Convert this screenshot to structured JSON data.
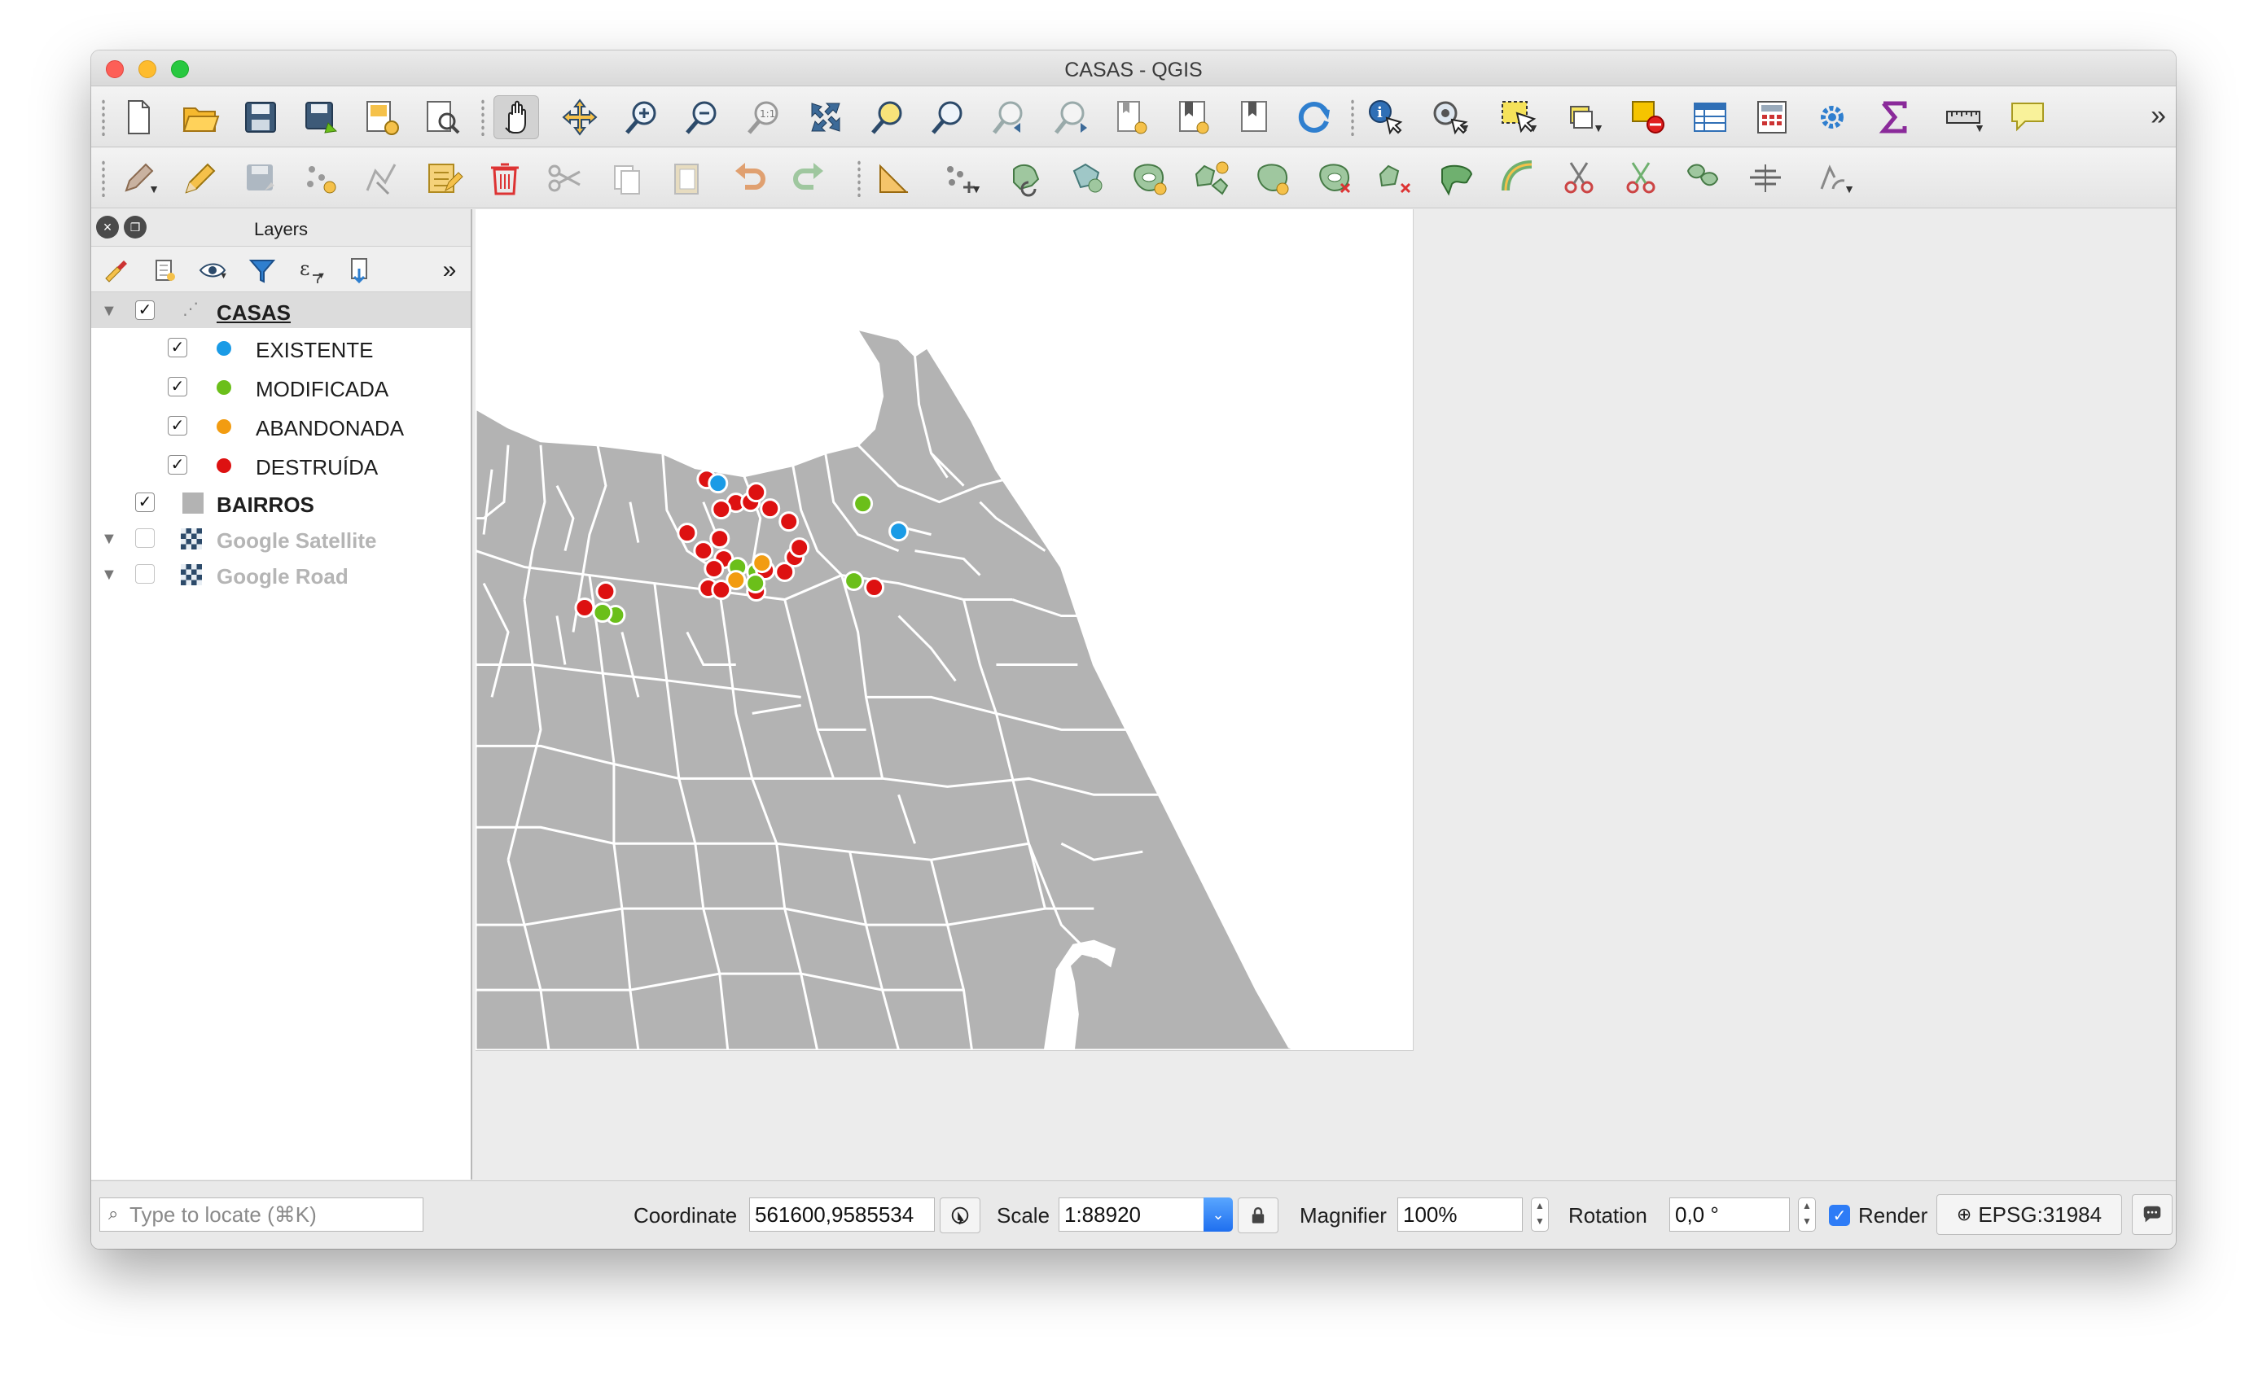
{
  "window": {
    "title": "CASAS - QGIS"
  },
  "toolbar1": {
    "icons": [
      "new-project-icon",
      "open-project-icon",
      "save-project-icon",
      "save-as-icon",
      "print-layout-icon",
      "layout-manager-icon",
      "pan-icon",
      "pan-to-selection-icon",
      "zoom-in-icon",
      "zoom-out-icon",
      "zoom-native-icon",
      "zoom-full-icon",
      "zoom-selection-icon",
      "zoom-layer-icon",
      "zoom-last-icon",
      "zoom-next-icon",
      "new-bookmark-icon",
      "show-bookmarks-icon",
      "temporal-icon",
      "refresh-icon",
      "identify-icon",
      "action-icon",
      "select-feature-icon",
      "attributes-icon",
      "deselect-icon",
      "attribute-table-icon",
      "field-calculator-icon",
      "processing-toolbox-icon",
      "statistics-sigma-icon",
      "measure-icon",
      "map-tips-icon"
    ]
  },
  "toolbar2": {
    "icons": [
      "digitizing-icon",
      "toggle-editing-icon",
      "save-edits-icon",
      "add-point-icon",
      "vertex-tool-icon",
      "modify-attributes-icon",
      "delete-selected-icon",
      "cut-features-icon",
      "copy-features-icon",
      "paste-features-icon",
      "undo-icon",
      "redo-icon",
      "digitize-angle-icon",
      "move-feature-icon",
      "rotate-feature-icon",
      "simplify-icon",
      "add-ring-icon",
      "add-part-icon",
      "fill-ring-icon",
      "delete-ring-icon",
      "delete-part-icon",
      "reshape-icon",
      "offset-curve-icon",
      "split-features-icon",
      "split-parts-icon",
      "merge-features-icon",
      "merge-attributes-icon",
      "rotate-point-symbols-icon"
    ]
  },
  "layers_panel": {
    "title": "Layers",
    "tools": [
      "open-styling-icon",
      "add-group-icon",
      "manage-visibility-icon",
      "filter-legend-icon",
      "filter-expression-icon",
      "remove-layer-icon",
      "more-icon"
    ],
    "layers": [
      {
        "name": "CASAS",
        "checked": true,
        "expanded": true,
        "type": "point",
        "selected": true,
        "classes": [
          {
            "label": "EXISTENTE",
            "color": "#1a9be6",
            "checked": true
          },
          {
            "label": "MODIFICADA",
            "color": "#6bbf1a",
            "checked": true
          },
          {
            "label": "ABANDONADA",
            "color": "#f29c11",
            "checked": true
          },
          {
            "label": "DESTRUÍDA",
            "color": "#dd1111",
            "checked": true
          }
        ]
      },
      {
        "name": "BAIRROS",
        "checked": true,
        "type": "polygon",
        "color": "#b3b3b3"
      },
      {
        "name": "Google Satellite",
        "checked": false,
        "type": "raster"
      },
      {
        "name": "Google Road",
        "checked": false,
        "type": "raster"
      }
    ]
  },
  "map": {
    "polygon_fill": "#b3b3b3",
    "boundary_color": "#ffffff"
  },
  "statusbar": {
    "locate_placeholder": "Type to locate (⌘K)",
    "coordinate_label": "Coordinate",
    "coordinate_value": "561600,9585534",
    "scale_label": "Scale",
    "scale_value": "1:88920",
    "magnifier_label": "Magnifier",
    "magnifier_value": "100%",
    "rotation_label": "Rotation",
    "rotation_value": "0,0 °",
    "render_label": "Render",
    "render_checked": true,
    "crs_label": "EPSG:31984"
  }
}
